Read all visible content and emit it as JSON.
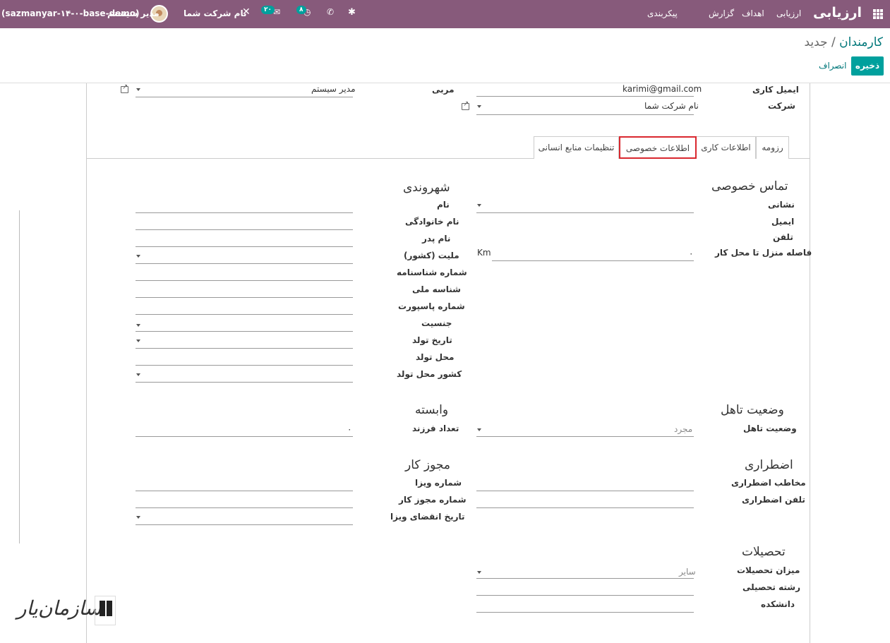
{
  "navbar": {
    "brand": "ارزیابی",
    "menu": [
      "ارزیابی",
      "اهداف",
      "گزارش",
      "پیکربندی"
    ],
    "db_name": "(sazmanyar-۱۴-۰-base-demo)",
    "user_name": "مدیر سیستم",
    "company": "نام شرکت شما",
    "activity_count": "۸",
    "message_count": "۲۰"
  },
  "breadcrumb": {
    "parent": "کارمندان",
    "sep": "/",
    "current": "جدید"
  },
  "buttons": {
    "save": "ذخیره",
    "discard": "انصراف"
  },
  "top_fields": {
    "work_email_label": "ایمیل کاری",
    "work_email_value": "karimi@gmail.com",
    "company_label": "شرکت",
    "company_value": "نام شرکت شما",
    "coach_label": "مربی",
    "coach_value": "مدیر سیستم"
  },
  "tabs": [
    "رزومه",
    "اطلاعات کاری",
    "اطلاعات خصوصی",
    "تنظیمات منابع انسانی"
  ],
  "private_contact": {
    "title": "تماس خصوصی",
    "address": "نشانی",
    "email": "ایمیل",
    "phone": "تلفن",
    "km_label": "فاصله منزل تا محل کار",
    "km_value": "۰",
    "km_unit": "Km"
  },
  "citizenship": {
    "title": "شهروندی",
    "labels": [
      "نام",
      "نام خانوادگی",
      "نام پدر",
      "ملیت (کشور)",
      "شماره شناسنامه",
      "شناسه ملی",
      "شماره پاسپورت",
      "جنسیت",
      "تاریخ تولد",
      "محل تولد",
      "کشور محل تولد"
    ]
  },
  "marital": {
    "title": "وضعیت تاهل",
    "label": "وضعیت تاهل",
    "value": "مجرد"
  },
  "dependant": {
    "title": "وابسته",
    "label": "تعداد فرزند",
    "value": "۰"
  },
  "emergency": {
    "title": "اضطراری",
    "contact": "مخاطب اضطراری",
    "phone": "تلفن اضطراری"
  },
  "work_permit": {
    "title": "مجوز کار",
    "labels": [
      "شماره ویزا",
      "شماره مجوز کار",
      "تاریخ انقضای ویزا"
    ]
  },
  "education": {
    "title": "تحصیلات",
    "level_label": "میزان تحصیلات",
    "level_value": "سایر",
    "field": "رشته تحصیلی",
    "school": "دانشکده"
  },
  "watermark": "سازمان‌یار"
}
